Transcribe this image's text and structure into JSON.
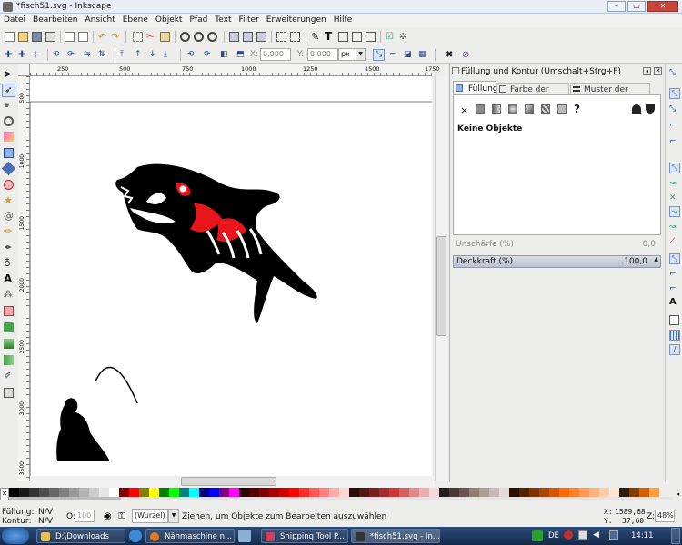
{
  "window": {
    "title": "*fisch51.svg - Inkscape"
  },
  "menu": [
    "Datei",
    "Bearbeiten",
    "Ansicht",
    "Ebene",
    "Objekt",
    "Pfad",
    "Text",
    "Filter",
    "Erweiterungen",
    "Hilfe"
  ],
  "toolbar": {
    "x_label": "X:",
    "x_value": "0,000",
    "y_label": "Y:",
    "y_value": "0,000",
    "unit": "px"
  },
  "ruler": {
    "top_ticks": [
      "250",
      "500",
      "750",
      "1000",
      "1250",
      "1500",
      "1750"
    ],
    "left_ticks": [
      "500",
      "1000",
      "1500",
      "2000",
      "2500",
      "3000",
      "3500"
    ]
  },
  "panel": {
    "title": "Füllung und Kontur (Umschalt+Strg+F)",
    "tabs": [
      "Füllung",
      "Farbe der Kontur",
      "Muster der Kontur"
    ],
    "paint_x": "×",
    "paint_q": "?",
    "empty_msg": "Keine Objekte",
    "blur_label": "Unschärfe (%)",
    "blur_value": "0,0",
    "opacity_label": "Deckkraft (%)",
    "opacity_value": "100,0"
  },
  "status": {
    "fill_label": "Füllung:",
    "fill_value": "N/V",
    "stroke_label": "Kontur:",
    "stroke_value": "N/V",
    "o_label": "O:",
    "o_value": "100",
    "layer": "(Wurzel)",
    "message": "Ziehen, um Objekte zum Bearbeiten auszuwählen",
    "x_label": "X:",
    "x_value": "1589,68",
    "y_label": "Y:",
    "y_value": "37,60",
    "z_label": "Z:",
    "zoom": "48%"
  },
  "taskbar": {
    "items": [
      "D:\\Downloads",
      "Nähmaschine n...",
      "Shipping Tool P...",
      "*fisch51.svg - In..."
    ],
    "lang": "DE",
    "clock": "14:11"
  },
  "colors": {
    "accent_red": "#e8161b",
    "palette": [
      "#000000",
      "#1a1a1a",
      "#333333",
      "#4d4d4d",
      "#666666",
      "#808080",
      "#999999",
      "#b3b3b3",
      "#cccccc",
      "#e6e6e6",
      "#ffffff",
      "#800000",
      "#ff0000",
      "#808000",
      "#ffff00",
      "#008000",
      "#00ff00",
      "#008080",
      "#00ffff",
      "#000080",
      "#0000ff",
      "#800080",
      "#ff00ff",
      "#2b0000",
      "#550000",
      "#800000",
      "#aa0000",
      "#d40000",
      "#ff0000",
      "#ff2a2a",
      "#ff5555",
      "#ff8080",
      "#ffaaaa",
      "#ffd5d5",
      "#280b0b",
      "#501616",
      "#782121",
      "#a02c2c",
      "#c83737",
      "#d35f5f",
      "#de8787",
      "#e9afaf",
      "#f4d7d7",
      "#241c1c",
      "#483737",
      "#6c5353",
      "#917c6f",
      "#ac9d93",
      "#c8b7b7",
      "#e3dbdb",
      "#2b1100",
      "#552200",
      "#803300",
      "#aa4400",
      "#d45500",
      "#ff6600",
      "#ff7f2a",
      "#ff9955",
      "#ffb380",
      "#ffccaa",
      "#ffe6d5",
      "#2b1d0e",
      "#803d00",
      "#d45f00",
      "#ff9f40"
    ]
  }
}
